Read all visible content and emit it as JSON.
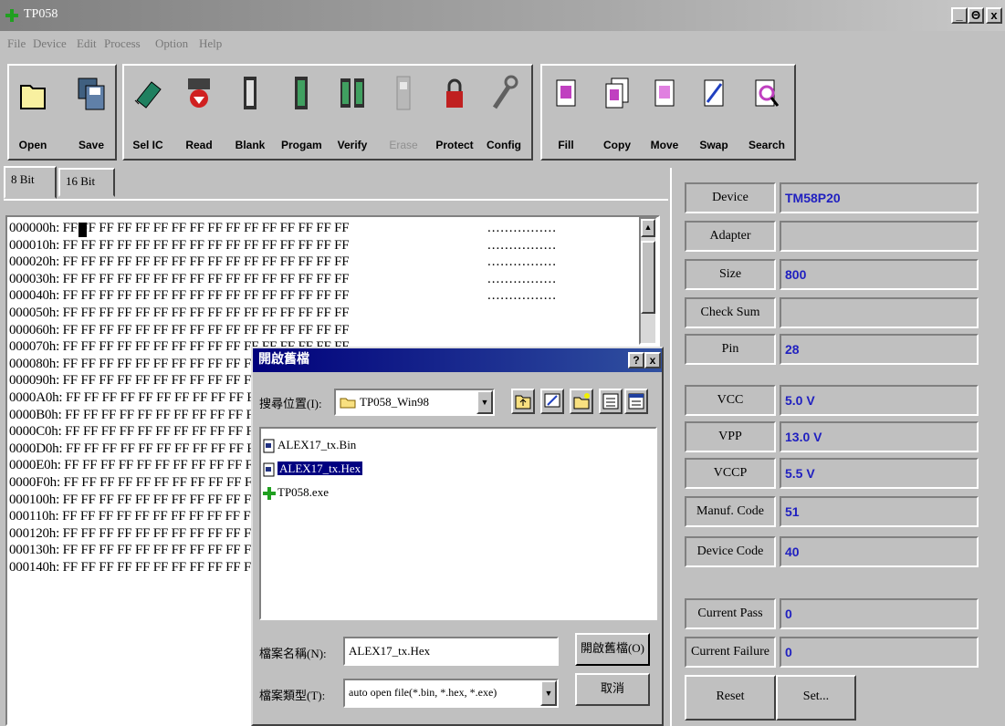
{
  "window": {
    "title": "TP058",
    "controls": [
      "_",
      "Θ",
      "x"
    ]
  },
  "menu": [
    "File",
    "Device",
    "Edit",
    "Process",
    "Option",
    "Help"
  ],
  "toolbar": {
    "open": "Open",
    "save": "Save",
    "sel_ic": "Sel IC",
    "read": "Read",
    "blank": "Blank",
    "program": "Progam",
    "verify": "Verify",
    "erase": "Erase",
    "protect": "Protect",
    "config": "Config",
    "fill": "Fill",
    "copy": "Copy",
    "move": "Move",
    "swap": "Swap",
    "search": "Search"
  },
  "tabs": [
    "8 Bit",
    "16 Bit"
  ],
  "hex": {
    "rows": [
      "000000h:",
      "000010h:",
      "000020h:",
      "000030h:",
      "000040h:",
      "000050h:",
      "000060h:",
      "000070h:",
      "000080h:",
      "000090h:",
      "0000A0h:",
      "0000B0h:",
      "0000C0h:",
      "0000D0h:",
      "0000E0h:",
      "0000F0h:",
      "000100h:",
      "000110h:",
      "000120h:",
      "000130h:",
      "000140h:"
    ],
    "byte": "FF",
    "ascii": "................"
  },
  "panel": {
    "device_label": "Device",
    "device_value": "TM58P20",
    "adapter_label": "Adapter",
    "adapter_value": "",
    "size_label": "Size",
    "size_value": "800",
    "checksum_label": "Check Sum",
    "checksum_value": "",
    "pin_label": "Pin",
    "pin_value": "28",
    "vcc_label": "VCC",
    "vcc_value": "5.0 V",
    "vpp_label": "VPP",
    "vpp_value": "13.0 V",
    "vccp_label": "VCCP",
    "vccp_value": "5.5 V",
    "manuf_label": "Manuf. Code",
    "manuf_value": "51",
    "devcode_label": "Device Code",
    "devcode_value": "40",
    "pass_label": "Current Pass",
    "pass_value": "0",
    "fail_label": "Current Failure",
    "fail_value": "0",
    "reset": "Reset",
    "set": "Set..."
  },
  "dialog": {
    "title": "開啟舊檔",
    "lookin_label": "搜尋位置(I):",
    "lookin_value": "TP058_Win98",
    "files": [
      "ALEX17_tx.Bin",
      "ALEX17_tx.Hex",
      "TP058.exe"
    ],
    "filename_label": "檔案名稱(N):",
    "filename_value": "ALEX17_tx.Hex",
    "filetype_label": "檔案類型(T):",
    "filetype_value": "auto open file(*.bin, *.hex, *.exe)",
    "open_btn": "開啟舊檔(O)",
    "cancel_btn": "取消",
    "help": "?",
    "close": "x"
  }
}
